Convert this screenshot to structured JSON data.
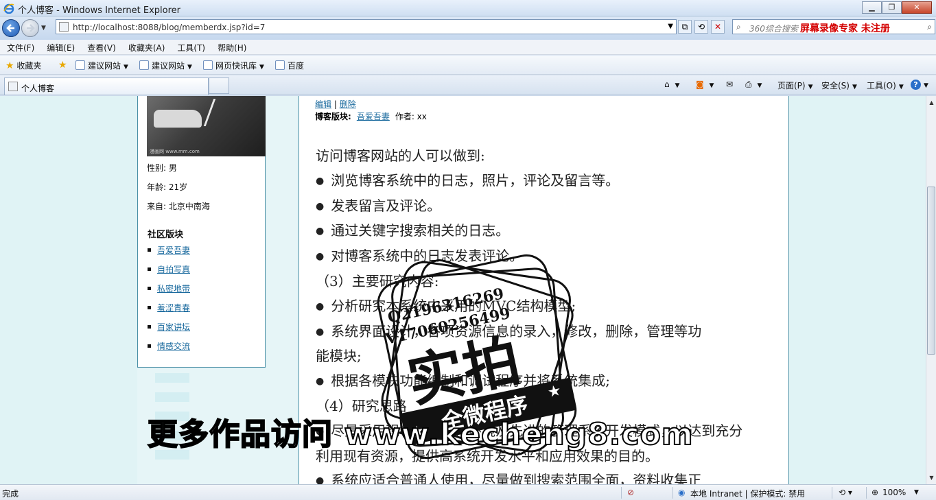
{
  "window": {
    "title": "个人博客 - Windows Internet Explorer",
    "buttons": {
      "minimize": "▁",
      "restore": "❐",
      "close": "✕"
    }
  },
  "address": {
    "url": "http://localhost:8088/blog/memberdx.jsp?id=7",
    "search_placeholder": "360综合搜索",
    "search_promo": "屏幕录像专家  未注册"
  },
  "menu": [
    "文件(F)",
    "编辑(E)",
    "查看(V)",
    "收藏夹(A)",
    "工具(T)",
    "帮助(H)"
  ],
  "favorites": {
    "label": "收藏夹",
    "items": [
      "建议网站",
      "建议网站",
      "网页快讯库",
      "百度"
    ]
  },
  "tab": {
    "title": "个人博客"
  },
  "commands": {
    "page": "页面(P)",
    "safety": "安全(S)",
    "tools": "工具(O)",
    "help": "?"
  },
  "sidebar": {
    "photo_caption": "漫画网 www.mm.com",
    "gender": "性别: 男",
    "age": "年龄: 21岁",
    "from": "来自: 北京中南海",
    "section_title": "社区版块",
    "links": [
      "吾爱吾妻",
      "自拍写真",
      "私密地带",
      "羞涩青春",
      "百家讲坛",
      "情感交流"
    ]
  },
  "post": {
    "edit": "编辑",
    "sep": "|",
    "delete": "删除",
    "board_label": "博客版块:",
    "board": "吾爱吾妻",
    "author": "作者: xx",
    "lines": [
      {
        "text": "访问博客网站的人可以做到:",
        "bullet": false
      },
      {
        "text": "浏览博客系统中的日志，照片，评论及留言等。",
        "bullet": true
      },
      {
        "text": "发表留言及评论。",
        "bullet": true
      },
      {
        "text": "通过关键字搜索相关的日志。",
        "bullet": true
      },
      {
        "text": "对博客系统中的日志发表评论。",
        "bullet": true
      },
      {
        "text": "（3）主要研究内容:",
        "bullet": false
      },
      {
        "text": "分析研究本系统中采用的MVC结构模型;",
        "bullet": true
      },
      {
        "text": "系统界面设计，各项资源信息的录入，修改，删除，管理等功",
        "bullet": true
      },
      {
        "text": "能模块;",
        "bullet": false
      },
      {
        "text": "根据各模块功能编制和调试程序并将系统集成;",
        "bullet": true
      },
      {
        "text": "（4）研究思路",
        "bullet": false
      },
      {
        "text": "尽量采用现有的软硬件环境及先进的管理系统开发模式，以达到充分",
        "bullet": true
      },
      {
        "text": "利用现有资源，提供高系统开发水平和应用效果的目的。",
        "bullet": false
      },
      {
        "text": "系统应适合普通人使用，尽量做到搜索范围全面，资料收集正",
        "bullet": true
      }
    ]
  },
  "watermark": {
    "qq": "Q2196316269",
    "phone": "V17060256499",
    "stamp_main": "实拍",
    "stamp_sub": "全微程序",
    "banner": "更多作品访问 www.kecheng8.com"
  },
  "status": {
    "text": "完成",
    "zone": "本地 Intranet | 保护模式: 禁用",
    "zoom": "100%"
  }
}
